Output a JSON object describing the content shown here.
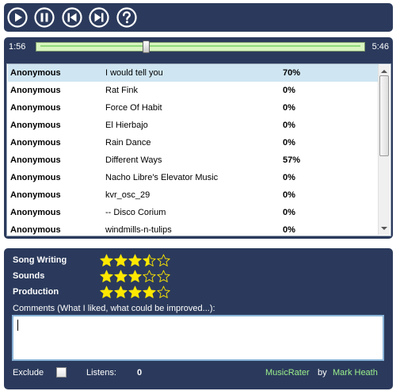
{
  "toolbar": {
    "buttons": [
      "play-icon",
      "pause-icon",
      "previous-icon",
      "next-icon",
      "help-icon"
    ]
  },
  "player": {
    "elapsed": "1:56",
    "total": "5:46",
    "position_fraction": 0.335
  },
  "songs": [
    {
      "artist": "Anonymous",
      "title": "I would tell you",
      "score": "70%",
      "selected": true
    },
    {
      "artist": "Anonymous",
      "title": "Rat Fink",
      "score": "0%"
    },
    {
      "artist": "Anonymous",
      "title": "Force Of Habit",
      "score": "0%"
    },
    {
      "artist": "Anonymous",
      "title": "El Hierbajo",
      "score": "0%"
    },
    {
      "artist": "Anonymous",
      "title": "Rain Dance",
      "score": "0%"
    },
    {
      "artist": "Anonymous",
      "title": "Different Ways",
      "score": "57%"
    },
    {
      "artist": "Anonymous",
      "title": "Nacho Libre's Elevator Music",
      "score": "0%"
    },
    {
      "artist": "Anonymous",
      "title": "kvr_osc_29",
      "score": "0%"
    },
    {
      "artist": "Anonymous",
      "title": "-- Disco Corium",
      "score": "0%"
    },
    {
      "artist": "Anonymous",
      "title": "windmills-n-tulips",
      "score": "0%"
    }
  ],
  "ratings": {
    "max": 5,
    "items": [
      {
        "label": "Song Writing",
        "value": 3.5
      },
      {
        "label": "Sounds",
        "value": 3
      },
      {
        "label": "Production",
        "value": 4
      }
    ]
  },
  "comments": {
    "label": "Comments (What I liked, what could be improved...):",
    "value": ""
  },
  "footer": {
    "exclude_label": "Exclude",
    "exclude_checked": false,
    "listens_label": "Listens:",
    "listens_value": "0",
    "app_name": "MusicRater",
    "by": "by",
    "author": "Mark Heath"
  },
  "colors": {
    "panel": "#2b3a5c",
    "selected_row": "#cfe6f2",
    "star": "#ffe800",
    "link_green": "#9cf08c"
  }
}
